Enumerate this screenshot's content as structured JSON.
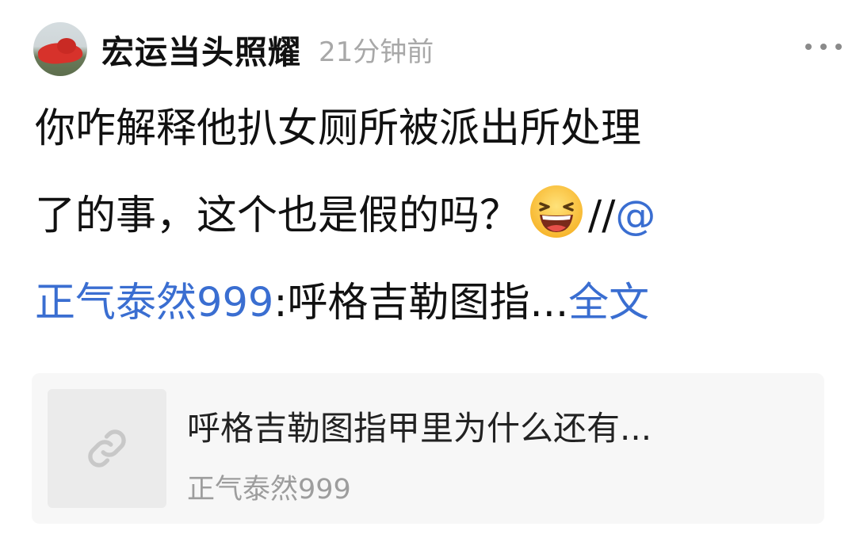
{
  "post": {
    "author": "宏运当头照耀",
    "time": "21分钟前",
    "text": {
      "line1": "你咋解释他扒女厕所被派出所处理",
      "line2_prefix": "了的事，这个也是假的吗？",
      "line2_slashes": "//",
      "line2_at": "@",
      "line3_mention": "正气泰然999",
      "line3_rest": ":呼格吉勒图指...",
      "full_text_link": "全文"
    },
    "emoji": "laughing-emoji",
    "more_icon": "more-dots-icon"
  },
  "card": {
    "title": "呼格吉勒图指甲里为什么还有...",
    "subtitle": "正气泰然999",
    "icon": "link-icon"
  },
  "colors": {
    "link": "#3a6ed1",
    "time": "#a8a8a8",
    "card_bg": "#f7f7f7"
  }
}
